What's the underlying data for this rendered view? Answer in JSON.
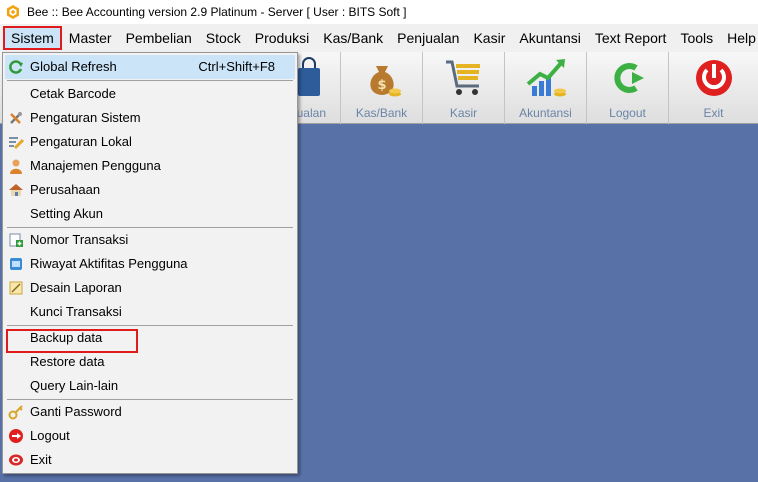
{
  "window": {
    "title": "Bee :: Bee Accounting version 2.9 Platinum - Server  [ User : BITS Soft ]",
    "app_icon": "bee-logo-icon"
  },
  "menubar": {
    "items": [
      {
        "label": "Sistem"
      },
      {
        "label": "Master"
      },
      {
        "label": "Pembelian"
      },
      {
        "label": "Stock"
      },
      {
        "label": "Produksi"
      },
      {
        "label": "Kas/Bank"
      },
      {
        "label": "Penjualan"
      },
      {
        "label": "Kasir"
      },
      {
        "label": "Akuntansi"
      },
      {
        "label": "Text Report"
      },
      {
        "label": "Tools"
      },
      {
        "label": "Help"
      }
    ]
  },
  "toolbar": {
    "buttons": [
      {
        "label": "ualan",
        "icon": "shopping-bag-icon"
      },
      {
        "label": "Kas/Bank",
        "icon": "money-bag-icon"
      },
      {
        "label": "Kasir",
        "icon": "cart-icon"
      },
      {
        "label": "Akuntansi",
        "icon": "growth-chart-icon"
      },
      {
        "label": "Logout",
        "icon": "logout-arrow-icon"
      },
      {
        "label": "Exit",
        "icon": "power-icon"
      }
    ]
  },
  "sistem_menu": {
    "items": [
      {
        "label": "Global Refresh",
        "shortcut": "Ctrl+Shift+F8",
        "icon": "refresh-icon"
      },
      {
        "label": "Cetak Barcode",
        "icon": ""
      },
      {
        "label": "Pengaturan Sistem",
        "icon": "tools-icon"
      },
      {
        "label": "Pengaturan Lokal",
        "icon": "edit-pencil-icon"
      },
      {
        "label": "Manajemen Pengguna",
        "icon": "user-icon"
      },
      {
        "label": "Perusahaan",
        "icon": "house-icon"
      },
      {
        "label": "Setting Akun",
        "icon": ""
      },
      {
        "label": "Nomor Transaksi",
        "icon": "add-document-icon"
      },
      {
        "label": "Riwayat Aktifitas Pengguna",
        "icon": "history-icon"
      },
      {
        "label": "Desain Laporan",
        "icon": "report-design-icon"
      },
      {
        "label": "Kunci Transaksi",
        "icon": ""
      },
      {
        "label": "Backup data",
        "icon": ""
      },
      {
        "label": "Restore data",
        "icon": ""
      },
      {
        "label": "Query Lain-lain",
        "icon": ""
      },
      {
        "label": "Ganti Password",
        "icon": "key-icon"
      },
      {
        "label": "Logout",
        "icon": "logout-icon"
      },
      {
        "label": "Exit",
        "icon": "exit-icon"
      }
    ],
    "highlighted_item": "Desain Laporan"
  }
}
